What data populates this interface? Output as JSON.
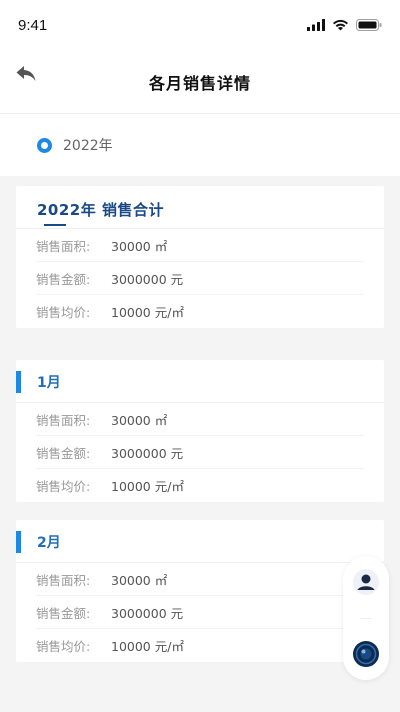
{
  "status_bar": {
    "time": "9:41",
    "icons": [
      "signal-icon",
      "wifi-icon",
      "battery-icon"
    ]
  },
  "nav": {
    "back_icon": "back-arrow-icon",
    "title": "各月销售详情"
  },
  "year_selector": {
    "selected": "2022年"
  },
  "total_card": {
    "title": "2022年  销售合计",
    "rows": [
      {
        "label": "销售面积:",
        "value": "30000 ㎡"
      },
      {
        "label": "销售金额:",
        "value": "3000000 元"
      },
      {
        "label": "销售均价:",
        "value": "10000 元/㎡"
      }
    ]
  },
  "months": [
    {
      "title": "1月",
      "rows": [
        {
          "label": "销售面积:",
          "value": "30000 ㎡"
        },
        {
          "label": "销售金额:",
          "value": "3000000 元"
        },
        {
          "label": "销售均价:",
          "value": "10000 元/㎡"
        }
      ]
    },
    {
      "title": "2月",
      "rows": [
        {
          "label": "销售面积:",
          "value": "30000 ㎡"
        },
        {
          "label": "销售金额:",
          "value": "3000000 元"
        },
        {
          "label": "销售均价:",
          "value": "10000 元/㎡"
        }
      ]
    }
  ],
  "floating_panel": {
    "icons": [
      "user-avatar-icon",
      "assistant-orb-icon"
    ]
  },
  "colors": {
    "accent": "#1e88e5",
    "title_blue": "#1a4a86",
    "background": "#f4f4f5"
  }
}
